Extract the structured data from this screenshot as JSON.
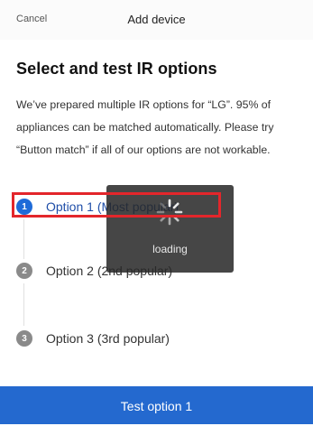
{
  "header": {
    "cancel_label": "Cancel",
    "title": "Add device"
  },
  "content": {
    "heading": "Select and test IR options",
    "description": "We’ve prepared multiple IR options for “LG”. 95% of appliances can be matched automatically. Please try “Button match” if all of our options are not workable."
  },
  "options": [
    {
      "number": "1",
      "label": "Option 1 (Most popular)",
      "selected": true
    },
    {
      "number": "2",
      "label": "Option 2 (2nd popular)",
      "selected": false
    },
    {
      "number": "3",
      "label": "Option 3 (3rd popular)",
      "selected": false
    }
  ],
  "loading_toast": {
    "text": "loading"
  },
  "footer": {
    "button_label": "Test option 1",
    "accent_color": "#2469cf"
  },
  "colors": {
    "selected_radio": "#1f6bd8",
    "unselected_radio": "#8a8a8a",
    "highlight_border": "#e3262b"
  }
}
